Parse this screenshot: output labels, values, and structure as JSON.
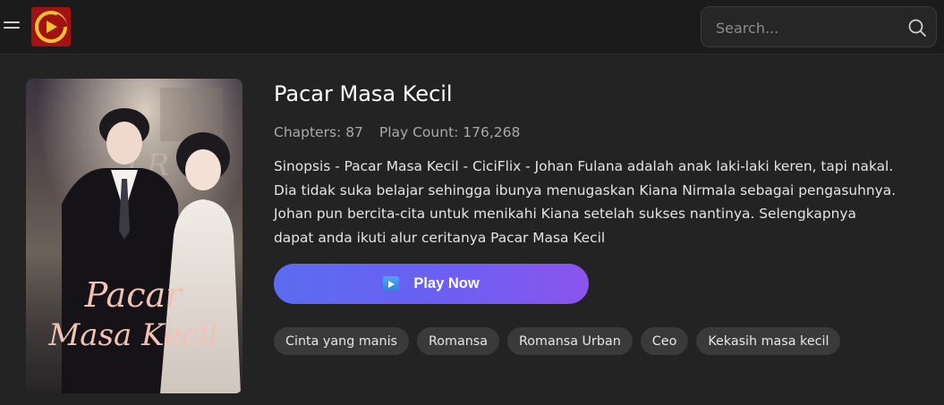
{
  "header": {
    "logo_alt": "app-logo",
    "search": {
      "placeholder": "Search..."
    }
  },
  "drama": {
    "title": "Pacar Masa Kecil",
    "chapters_label": "Chapters: 87",
    "play_count_label": "Play Count: 176,268",
    "synopsis_lines": [
      "Sinopsis - Pacar Masa Kecil - CiciFlix - Johan Fulana adalah anak laki-laki keren, tapi nakal.",
      "Dia tidak suka belajar sehingga ibunya menugaskan Kiana Nirmala sebagai pengasuhnya.",
      "Johan pun bercita-cita untuk menikahi Kiana setelah sukses nantinya. Selengkapnya",
      "dapat anda ikuti alur ceritanya Pacar Masa Kecil"
    ],
    "poster": {
      "title_line1": "Pacar",
      "title_line2": "Masa Kecil",
      "monogram": "LR"
    },
    "play_button_label": "Play Now",
    "tags": [
      "Cinta yang manis",
      "Romansa",
      "Romansa Urban",
      "Ceo",
      "Kekasih masa kecil"
    ]
  },
  "colors": {
    "background": "#232323",
    "header_bg": "#1b1b1b",
    "button_gradient_start": "#5b6cf0",
    "button_gradient_end": "#8a55ee",
    "tag_bg": "#3a3a3a",
    "logo_bg": "#a31212"
  }
}
